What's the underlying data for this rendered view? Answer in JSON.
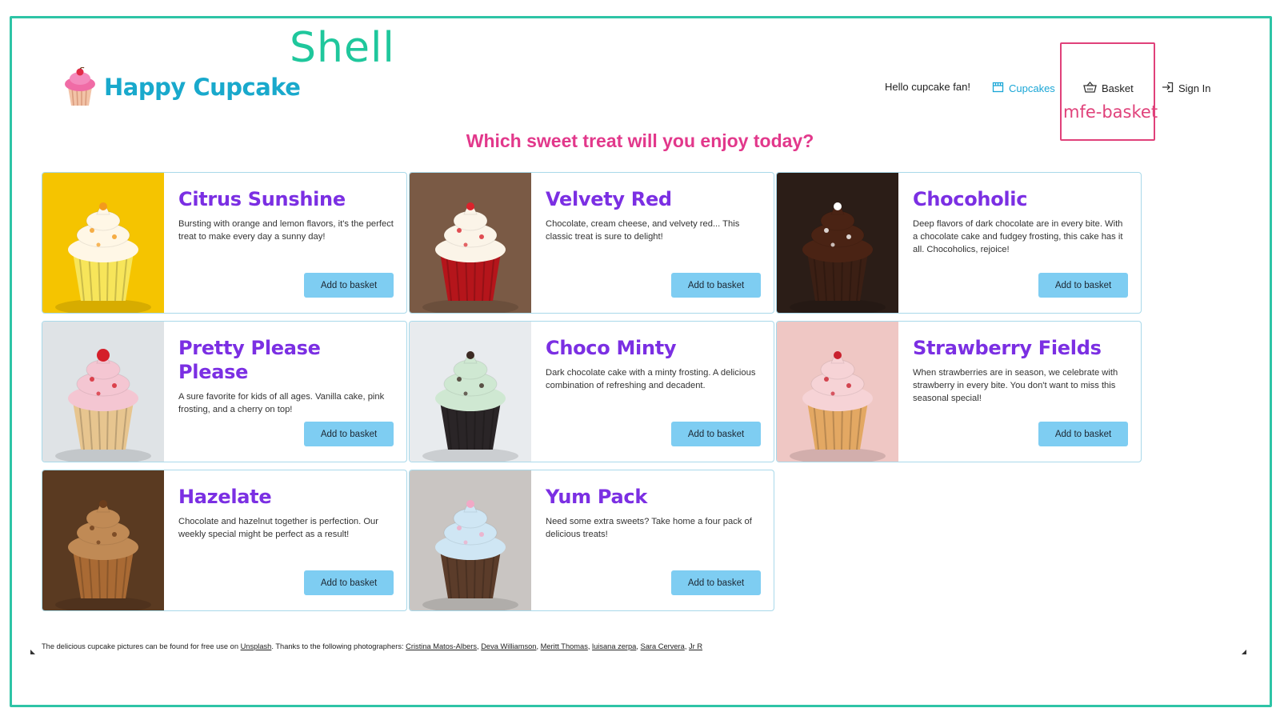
{
  "shell": {
    "label": "Shell",
    "mfe_label": "mfe-basket"
  },
  "header": {
    "brand": "Happy Cupcake",
    "greeting": "Hello cupcake fan!",
    "nav": [
      {
        "label": "Cupcakes",
        "icon": "shop-icon",
        "active": true
      },
      {
        "label": "Basket",
        "icon": "basket-icon",
        "active": false
      },
      {
        "label": "Sign In",
        "icon": "sign-in-icon",
        "active": false
      }
    ]
  },
  "headline": "Which sweet treat will you enjoy today?",
  "products": [
    {
      "title": "Citrus Sunshine",
      "description": "Bursting with orange and lemon flavors, it's the perfect treat to make every day a sunny day!",
      "button": "Add to basket",
      "bg": "#f5c400",
      "frosting": "#fff7e6",
      "cake": "#f7e55a",
      "topping": "#f39a1d"
    },
    {
      "title": "Velvety Red",
      "description": "Chocolate, cream cheese, and velvety red... This classic treat is sure to delight!",
      "button": "Add to basket",
      "bg": "#7a5a45",
      "frosting": "#fbf4e8",
      "cake": "#b5151b",
      "topping": "#d9232c"
    },
    {
      "title": "Chocoholic",
      "description": "Deep flavors of dark chocolate are in every bite. With a chocolate cake and fudgey frosting, this cake has it all. Chocoholics, rejoice!",
      "button": "Add to basket",
      "bg": "#2b1d17",
      "frosting": "#4a2314",
      "cake": "#3b1f14",
      "topping": "#ffffff"
    },
    {
      "title": "Pretty Please Please",
      "description": "A sure favorite for kids of all ages. Vanilla cake, pink frosting, and a cherry on top!",
      "button": "Add to basket",
      "bg": "#dfe3e6",
      "frosting": "#f4c6d2",
      "cake": "#e7c58f",
      "topping": "#d41f2a"
    },
    {
      "title": "Choco Minty",
      "description": "Dark chocolate cake with a minty frosting. A delicious combination of refreshing and decadent.",
      "button": "Add to basket",
      "bg": "#e8ebee",
      "frosting": "#cfe8d2",
      "cake": "#2a2527",
      "topping": "#3c2a23"
    },
    {
      "title": "Strawberry Fields",
      "description": "When strawberries are in season, we celebrate with strawberry in every bite. You don't want to miss this seasonal special!",
      "button": "Add to basket",
      "bg": "#efc7c4",
      "frosting": "#f6d3d6",
      "cake": "#e3a863",
      "topping": "#c9202d"
    },
    {
      "title": "Hazelate",
      "description": "Chocolate and hazelnut together is perfection. Our weekly special might be perfect as a result!",
      "button": "Add to basket",
      "bg": "#5a3a21",
      "frosting": "#c08a55",
      "cake": "#a96a34",
      "topping": "#6b3d1c"
    },
    {
      "title": "Yum Pack",
      "description": "Need some extra sweets? Take home a four pack of delicious treats!",
      "button": "Add to basket",
      "bg": "#c9c5c2",
      "frosting": "#cfe6f4",
      "cake": "#5b3c2a",
      "topping": "#f1a9c6"
    }
  ],
  "credits": {
    "prefix": "The delicious cupcake pictures can be found for free use on",
    "unsplash": "Unsplash",
    "middle": ". Thanks to the following photographers:",
    "photographers": [
      "Cristina Matos-Albers",
      "Deva Williamson",
      "Meritt Thomas",
      "luisana zerpa",
      "Sara Cervera",
      "Jr R"
    ]
  },
  "colors": {
    "accent": "#1aa6d6",
    "title": "#7b2fe3",
    "headline": "#e2388b",
    "button": "#7ecdf2",
    "shell": "#2ec4a6",
    "mfe": "#e0417a"
  }
}
